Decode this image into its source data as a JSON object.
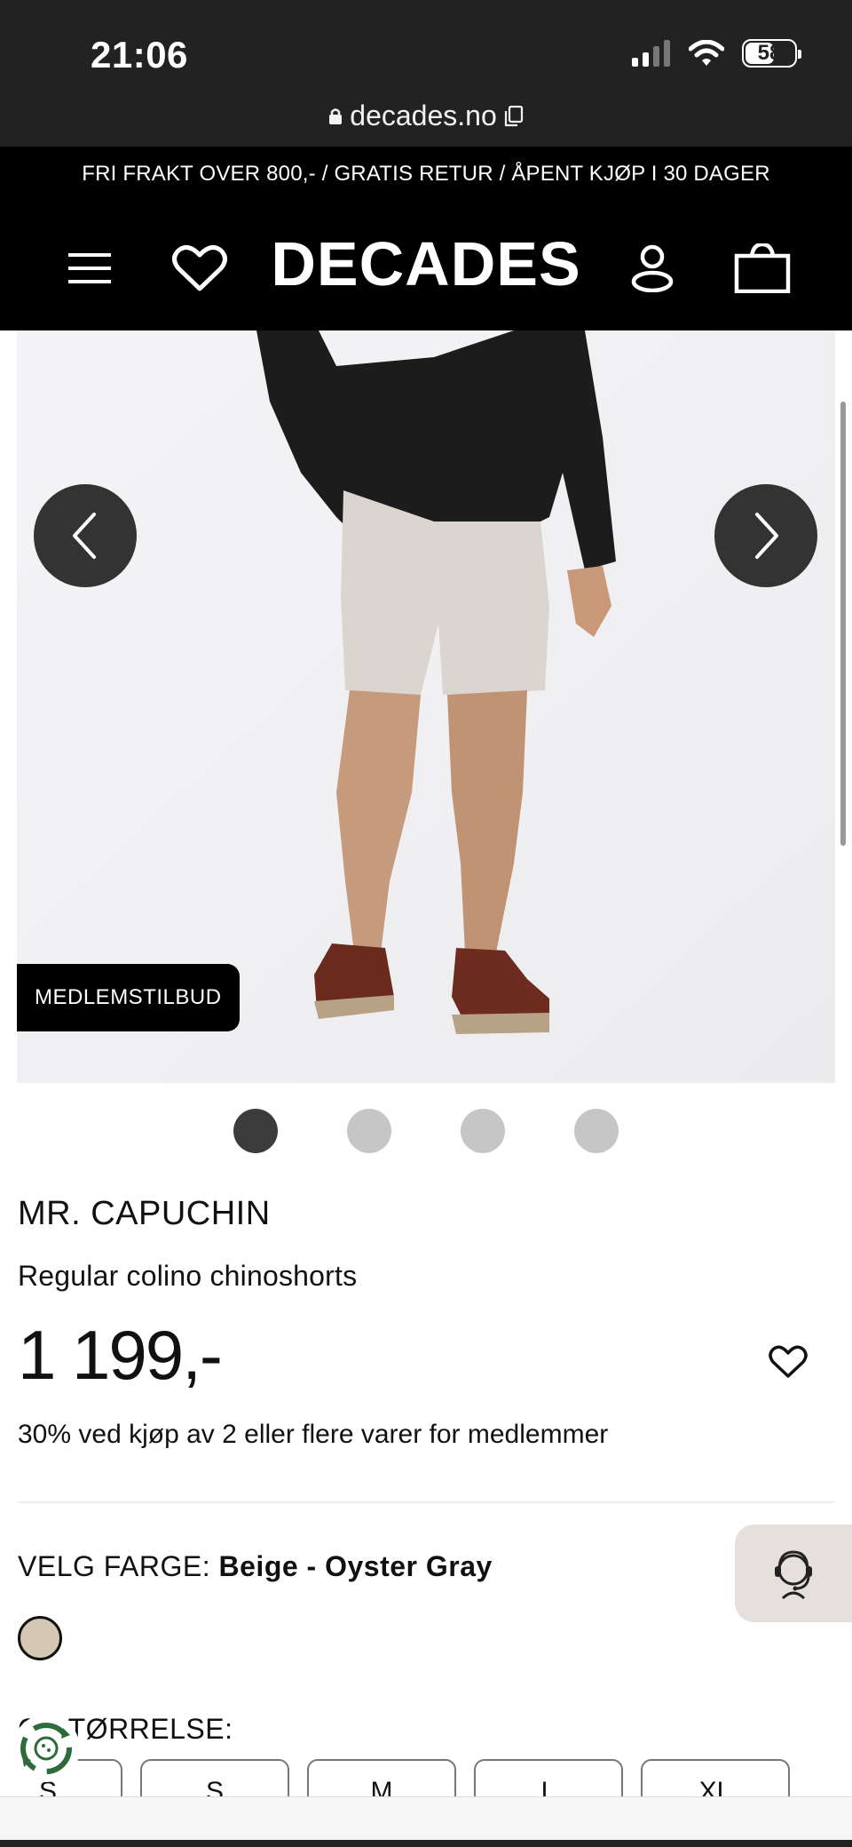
{
  "status_bar": {
    "time": "21:06",
    "battery": "58"
  },
  "browser": {
    "url": "decades.no"
  },
  "promo_banner": {
    "text": "FRI FRAKT OVER 800,- / GRATIS RETUR / ÅPENT KJØP I 30 DAGER"
  },
  "header": {
    "logo": "DECADES"
  },
  "gallery": {
    "badge": "MEDLEMSTILBUD",
    "image_count": 4,
    "active_index": 0
  },
  "product": {
    "brand": "MR. CAPUCHIN",
    "name": "Regular colino chinoshorts",
    "price": "1 199,-",
    "member_offer": "30% ved kjøp av 2 eller flere varer for medlemmer"
  },
  "color_selector": {
    "label": "VELG FARGE:",
    "selected": "Beige - Oyster Gray",
    "swatch_color": "#d4c8b4"
  },
  "size_selector": {
    "label_visible": "G STØRRELSE:",
    "sizes": [
      "S",
      "S",
      "M",
      "L",
      "XL"
    ]
  },
  "colors": {
    "primary": "#000000",
    "accent": "#333333"
  }
}
